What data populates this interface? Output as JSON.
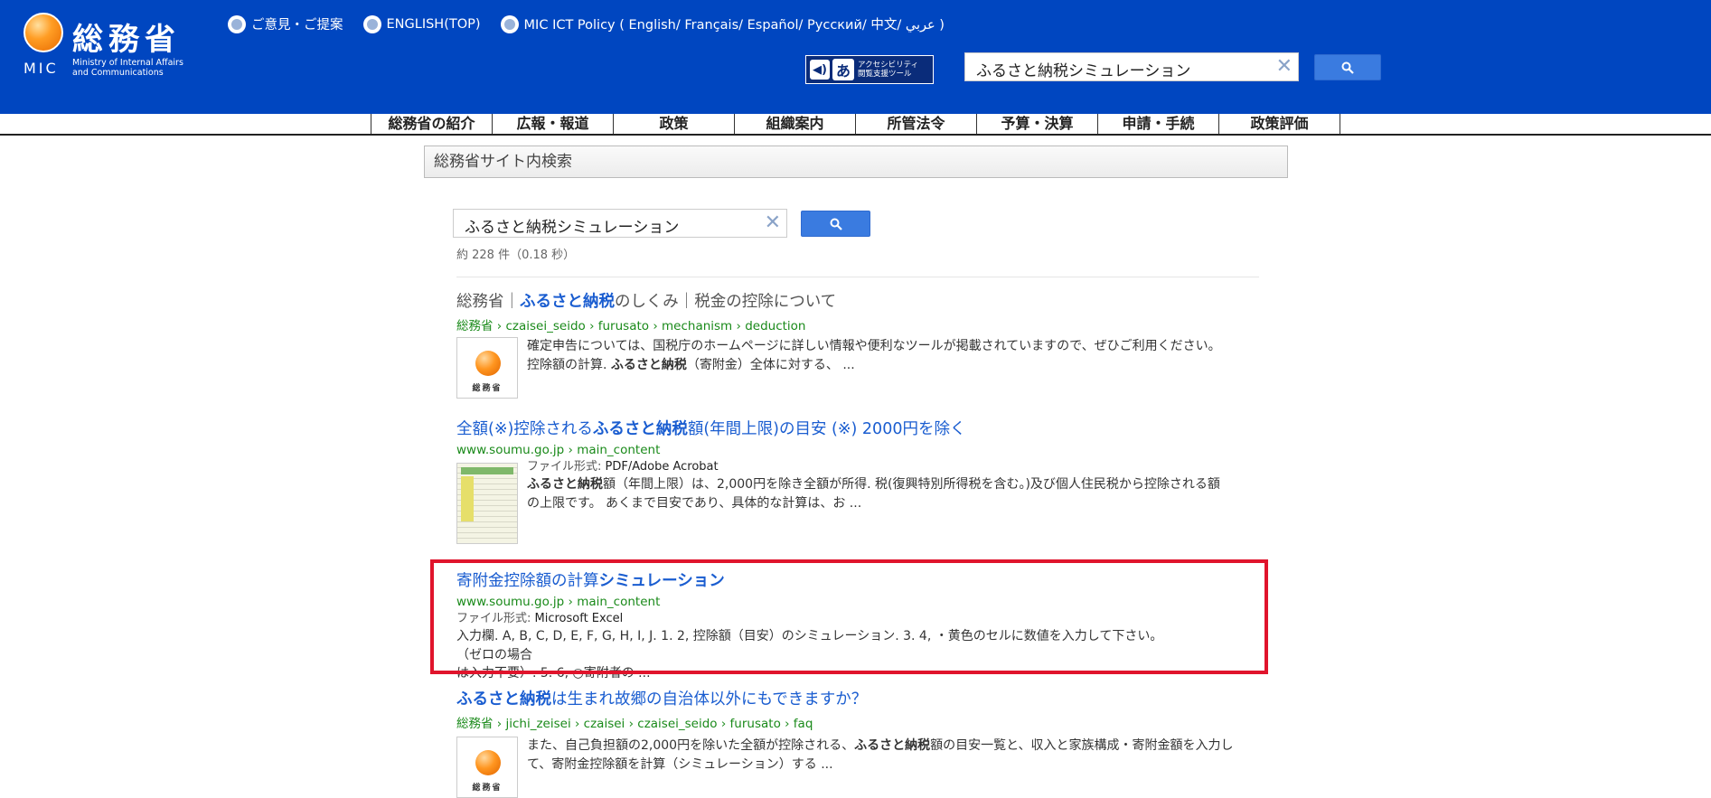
{
  "header": {
    "logo": {
      "kanji": "総務省",
      "mic": "MIC",
      "sub_line1": "Ministry of Internal Affairs",
      "sub_line2": "and Communications"
    },
    "top_links": [
      "ご意見・ご提案",
      "ENGLISH(TOP)",
      "MIC ICT Policy ( English/ Français/ Español/ Русский/ 中文/ عربي )"
    ],
    "accessibility": {
      "label_line1": "アクセシビリティ",
      "label_line2": "閲覧支援ツール",
      "glyph": "あ"
    },
    "search": {
      "value": "ふるさと納税シミュレーション"
    }
  },
  "nav": [
    "総務省の紹介",
    "広報・報道",
    "政策",
    "組織案内",
    "所管法令",
    "予算・決算",
    "申請・手続",
    "政策評価"
  ],
  "page_title": "総務省サイト内検索",
  "site_search": {
    "value": "ふるさと納税シミュレーション",
    "stats": "約 228 件（0.18 秒）"
  },
  "results": [
    {
      "title_pre": "総務省｜",
      "title_bold": "ふるさと納税",
      "title_post": "のしくみ｜税金の控除について",
      "url": "総務省 › czaisei_seido › furusato › mechanism › deduction",
      "thumb_label": "総務省",
      "snippet_l1": "確定申告については、国税庁のホームページに詳しい情報や便利なツールが掲載されていますので、ぜひご利用ください。",
      "snippet_l2_pre": "控除額の計算. ",
      "snippet_l2_bold": "ふるさと納税",
      "snippet_l2_post": "（寄附金）全体に対する、 ..."
    },
    {
      "title_pre": "全額(※)控除される",
      "title_bold": "ふるさと納税",
      "title_post": "額(年間上限)の目安 (※) 2000円を除く",
      "url": "www.soumu.go.jp › main_content",
      "filetype_label": "ファイル形式: ",
      "filetype": "PDF/Adobe Acrobat",
      "snippet_l1_bold": "ふるさと納税",
      "snippet_l1_post": "額（年間上限）は、2,000円を除き全額が所得. 税(復興特別所得税を含む。)及び個人住民税から控除される額",
      "snippet_l2": "の上限です。 あくまで目安であり、具体的な計算は、お ..."
    },
    {
      "title_pre": "寄附金控除額の計算",
      "title_bold": "シミュレーション",
      "url": "www.soumu.go.jp › main_content",
      "filetype_label": "ファイル形式: ",
      "filetype": "Microsoft Excel",
      "snippet_l1": "入力欄. A, B, C, D, E, F, G, H, I, J. 1. 2, 控除額（目安）のシミュレーション. 3. 4, ・黄色のセルに数値を入力して下さい。（ゼロの場合",
      "snippet_l2": "は入力不要）. 5. 6, ○寄附者の ..."
    },
    {
      "title_bold": "ふるさと納税",
      "title_post": "は生まれ故郷の自治体以外にもできますか？",
      "url": "総務省 › jichi_zeisei › czaisei › czaisei_seido › furusato › faq",
      "thumb_label": "総務省",
      "snippet_l1_pre": "また、自己負担額の2,000円を除いた全額が控除される、",
      "snippet_l1_bold": "ふるさと納税",
      "snippet_l1_post": "額の目安一覧と、収入と家族構成・寄附金額を入力し",
      "snippet_l2": "て、寄附金控除額を計算（シミュレーション）する ..."
    }
  ]
}
